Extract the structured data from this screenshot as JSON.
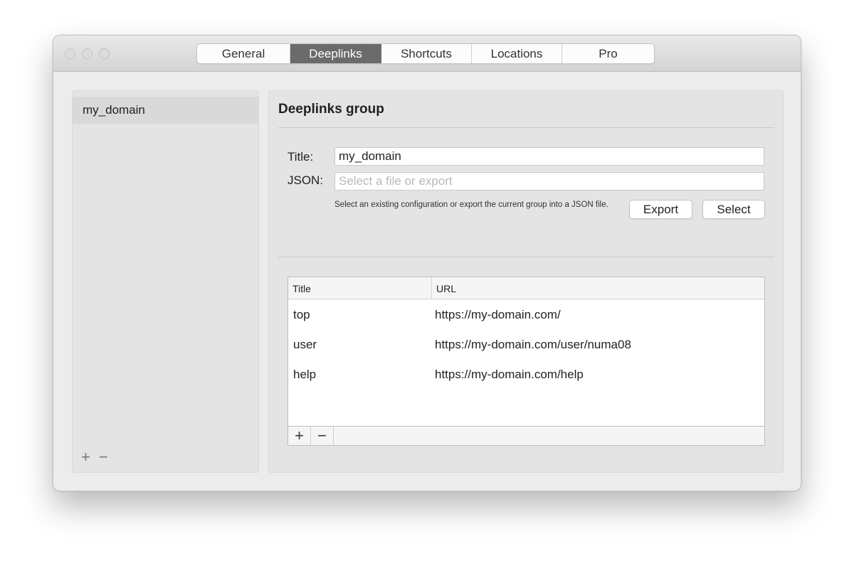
{
  "tabs": [
    {
      "label": "General"
    },
    {
      "label": "Deeplinks"
    },
    {
      "label": "Shortcuts"
    },
    {
      "label": "Locations"
    },
    {
      "label": "Pro"
    }
  ],
  "active_tab": "Deeplinks",
  "sidebar": {
    "items": [
      {
        "label": "my_domain"
      }
    ],
    "add_symbol": "+",
    "remove_symbol": "−"
  },
  "panel": {
    "title": "Deeplinks group",
    "title_label": "Title:",
    "title_value": "my_domain",
    "json_label": "JSON:",
    "json_placeholder": "Select a file or export",
    "help_text": "Select an existing configuration or export the current group into a JSON file.",
    "export_label": "Export",
    "select_label": "Select"
  },
  "table": {
    "columns": [
      "Title",
      "URL"
    ],
    "rows": [
      {
        "title": "top",
        "url": "https://my-domain.com/"
      },
      {
        "title": "user",
        "url": "https://my-domain.com/user/numa08"
      },
      {
        "title": "help",
        "url": "https://my-domain.com/help"
      }
    ],
    "add_symbol": "+",
    "remove_symbol": "−"
  }
}
